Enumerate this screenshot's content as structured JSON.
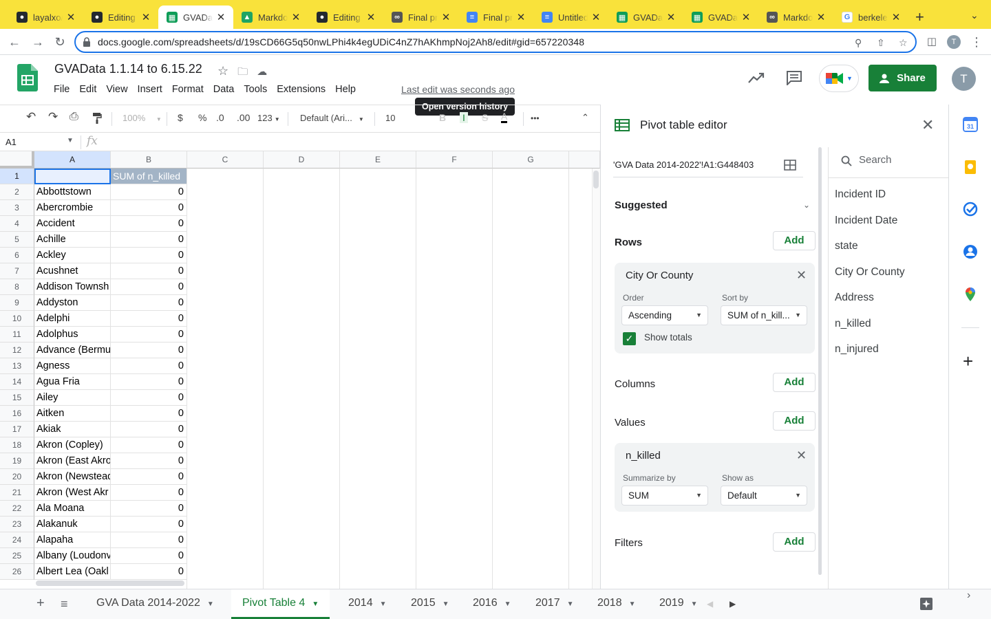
{
  "browser": {
    "tabs": [
      {
        "title": "layalxo/",
        "favicon": "github"
      },
      {
        "title": "Editing",
        "favicon": "github"
      },
      {
        "title": "GVADat",
        "favicon": "sheets",
        "active": true
      },
      {
        "title": "Markdo",
        "favicon": "drive"
      },
      {
        "title": "Editing",
        "favicon": "github"
      },
      {
        "title": "Final pr",
        "favicon": "colab"
      },
      {
        "title": "Final pr",
        "favicon": "docs"
      },
      {
        "title": "Untitled",
        "favicon": "docs"
      },
      {
        "title": "GVADat",
        "favicon": "sheets"
      },
      {
        "title": "GVADat",
        "favicon": "sheets"
      },
      {
        "title": "Markdo",
        "favicon": "colab"
      },
      {
        "title": "berkele",
        "favicon": "google"
      }
    ],
    "url": "docs.google.com/spreadsheets/d/19sCD66G5q50nwLPhi4k4egUDiC4nZ7hAKhmpNoj2Ah8/edit#gid=657220348",
    "profile_initial": "T"
  },
  "doc": {
    "title": "GVAData 1.1.14 to 6.15.22",
    "last_edit": "Last edit was seconds ago",
    "tooltip": "Open version history",
    "menu": [
      "File",
      "Edit",
      "View",
      "Insert",
      "Format",
      "Data",
      "Tools",
      "Extensions",
      "Help"
    ],
    "share_label": "Share",
    "avatar_initial": "T"
  },
  "toolbar": {
    "zoom": "100%",
    "currency": "$",
    "percent": "%",
    "dec_decrease": ".0",
    "dec_increase": ".00",
    "format_more": "123",
    "font": "Default (Ari...",
    "font_size": "10",
    "more": "•••"
  },
  "formula": {
    "cell_ref": "A1",
    "fx": "fx"
  },
  "grid": {
    "columns": [
      "A",
      "B",
      "C",
      "D",
      "E",
      "F",
      "G"
    ],
    "header_b": "SUM of n_killed",
    "rows": [
      {
        "n": "1",
        "a": "",
        "b": ""
      },
      {
        "n": "2",
        "a": "Abbottstown",
        "b": "0"
      },
      {
        "n": "3",
        "a": "Abercrombie",
        "b": "0"
      },
      {
        "n": "4",
        "a": "Accident",
        "b": "0"
      },
      {
        "n": "5",
        "a": "Achille",
        "b": "0"
      },
      {
        "n": "6",
        "a": "Ackley",
        "b": "0"
      },
      {
        "n": "7",
        "a": "Acushnet",
        "b": "0"
      },
      {
        "n": "8",
        "a": "Addison Townsh",
        "b": "0"
      },
      {
        "n": "9",
        "a": "Addyston",
        "b": "0"
      },
      {
        "n": "10",
        "a": "Adelphi",
        "b": "0"
      },
      {
        "n": "11",
        "a": "Adolphus",
        "b": "0"
      },
      {
        "n": "12",
        "a": "Advance (Bermu",
        "b": "0"
      },
      {
        "n": "13",
        "a": "Agness",
        "b": "0"
      },
      {
        "n": "14",
        "a": "Agua Fria",
        "b": "0"
      },
      {
        "n": "15",
        "a": "Ailey",
        "b": "0"
      },
      {
        "n": "16",
        "a": "Aitken",
        "b": "0"
      },
      {
        "n": "17",
        "a": "Akiak",
        "b": "0"
      },
      {
        "n": "18",
        "a": "Akron (Copley)",
        "b": "0"
      },
      {
        "n": "19",
        "a": "Akron (East Akro",
        "b": "0"
      },
      {
        "n": "20",
        "a": "Akron (Newstead",
        "b": "0"
      },
      {
        "n": "21",
        "a": "Akron (West Akr",
        "b": "0"
      },
      {
        "n": "22",
        "a": "Ala Moana",
        "b": "0"
      },
      {
        "n": "23",
        "a": "Alakanuk",
        "b": "0"
      },
      {
        "n": "24",
        "a": "Alapaha",
        "b": "0"
      },
      {
        "n": "25",
        "a": "Albany (Loudonv",
        "b": "0"
      },
      {
        "n": "26",
        "a": "Albert Lea (Oakl",
        "b": "0"
      }
    ]
  },
  "sheets": {
    "tabs": [
      {
        "label": "GVA Data 2014-2022",
        "active": false
      },
      {
        "label": "Pivot Table 4",
        "active": true
      },
      {
        "label": "2014",
        "active": false
      },
      {
        "label": "2015",
        "active": false
      },
      {
        "label": "2016",
        "active": false
      },
      {
        "label": "2017",
        "active": false
      },
      {
        "label": "2018",
        "active": false
      },
      {
        "label": "2019",
        "active": false
      }
    ]
  },
  "pivot": {
    "title": "Pivot table editor",
    "range": "'GVA Data 2014-2022'!A1:G448403",
    "suggested": "Suggested",
    "rows_label": "Rows",
    "columns_label": "Columns",
    "values_label": "Values",
    "filters_label": "Filters",
    "add_label": "Add",
    "row_card": {
      "title": "City Or County",
      "order_label": "Order",
      "order_value": "Ascending",
      "sort_label": "Sort by",
      "sort_value": "SUM of n_kill...",
      "show_totals": "Show totals"
    },
    "value_card": {
      "title": "n_killed",
      "summarize_label": "Summarize by",
      "summarize_value": "SUM",
      "show_as_label": "Show as",
      "show_as_value": "Default"
    },
    "search_placeholder": "Search",
    "fields": [
      "Incident ID",
      "Incident Date",
      "state",
      "City Or County",
      "Address",
      "n_killed",
      "n_injured"
    ]
  },
  "colors": {
    "accent_green": "#188038",
    "tab_strip": "#f9e23b",
    "header_cell": "#a3b4c6",
    "selection_blue": "#1a73e8"
  }
}
